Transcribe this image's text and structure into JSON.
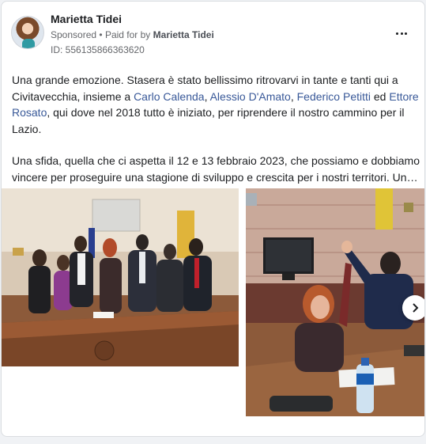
{
  "post": {
    "author": "Marietta Tidei",
    "sponsored": "Sponsored",
    "separator": "•",
    "paid_for_prefix": "Paid for by",
    "paid_for_by": "Marietta Tidei",
    "id_label": "ID: 556135866363620",
    "more_icon": "more-horizontal-icon"
  },
  "text": {
    "p1_a": "Una grande emozione. Stasera è stato bellissimo ritrovarvi in tante e tanti qui a Civitavecchia, insieme a ",
    "link1": "Carlo Calenda",
    "sep1": ", ",
    "link2": "Alessio D'Amato",
    "sep2": ", ",
    "link3": "Federico Petitti",
    "sep3": " ed ",
    "link4": "Ettore Rosato",
    "p1_b": ", qui dove nel 2018 tutto è iniziato, per riprendere il nostro cammino per il Lazio.",
    "p2_line1": "Una sfida, quella che ci aspetta il 12 e 13 febbraio 2023, che possiamo e dobbiamo",
    "p2_line2": "vincere per proseguire una stagione di sviluppo e crescita per i nostri territori. Un…"
  },
  "carousel": {
    "next_icon": "chevron-right-icon"
  },
  "colors": {
    "link": "#385898",
    "muted": "#65676b"
  }
}
